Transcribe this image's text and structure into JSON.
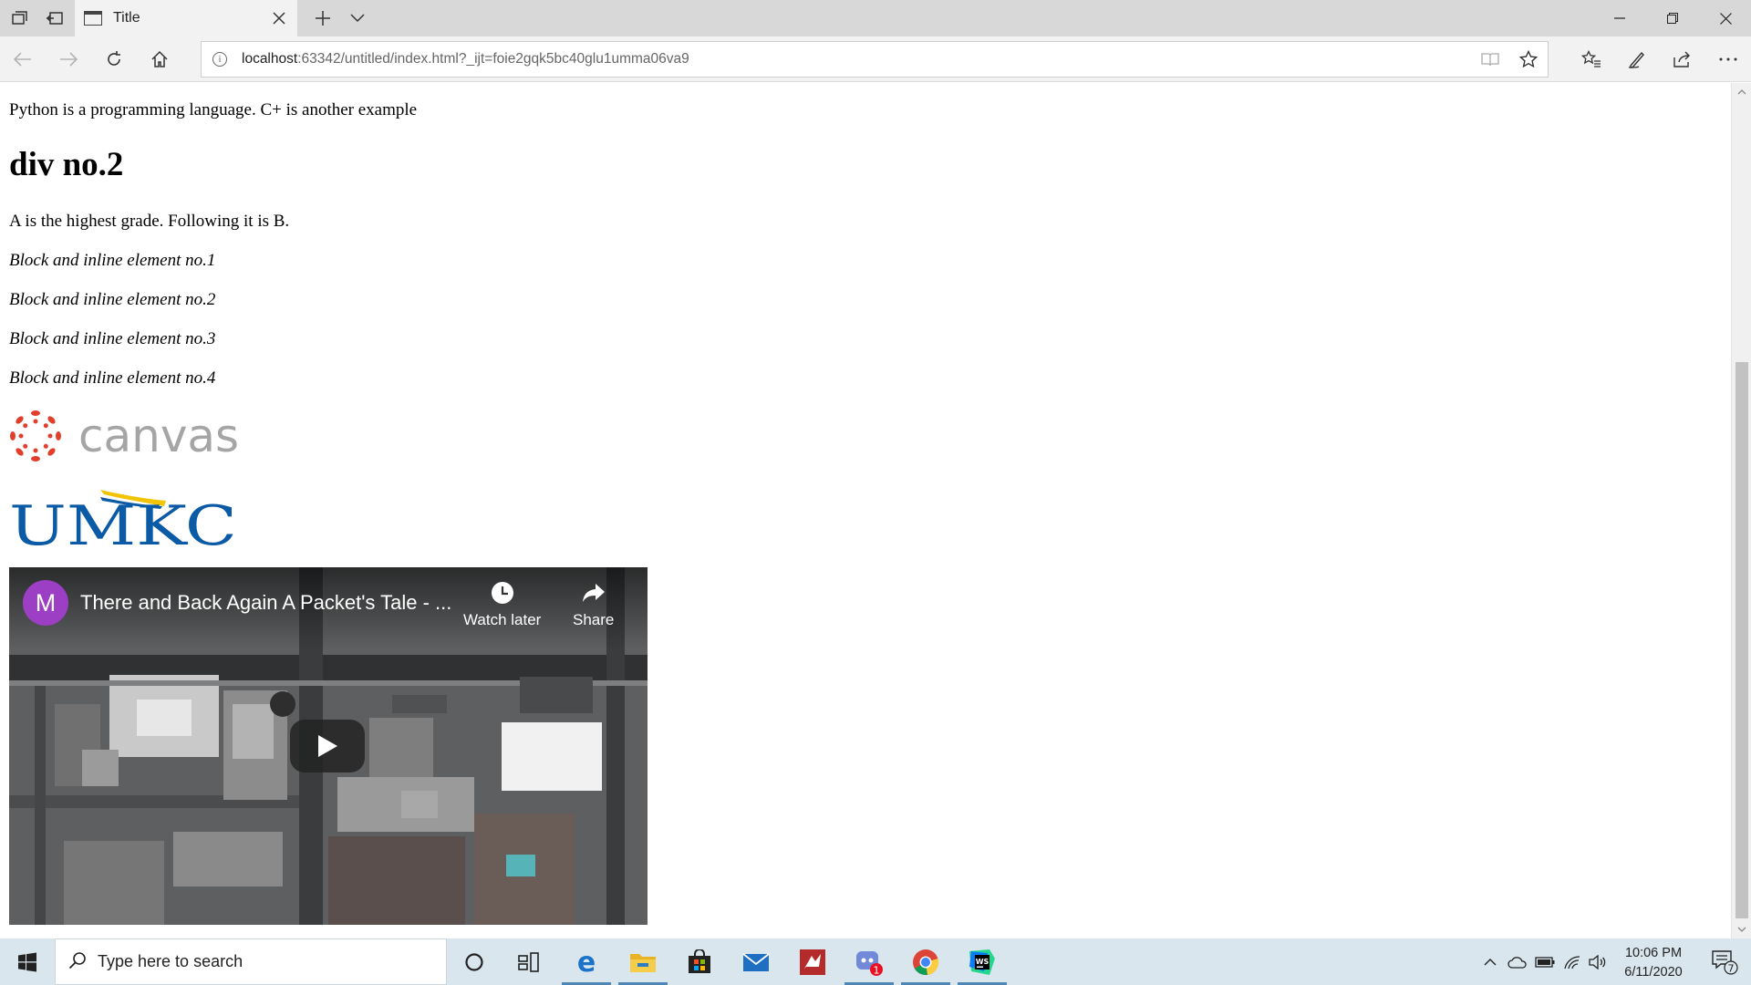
{
  "browser": {
    "tab": {
      "title": "Title"
    },
    "address": {
      "host": "localhost",
      "rest": ":63342/untitled/index.html?_ijt=foie2gqk5bc40glu1umma06va9"
    }
  },
  "page": {
    "para1": "Python is a programming language. C+ is another example",
    "heading2": "div no.2",
    "para2": "A is the highest grade. Following it is B.",
    "items": [
      "Block and inline element no.1",
      "Block and inline element no.2",
      "Block and inline element no.3",
      "Block and inline element no.4"
    ],
    "canvas_logo_text": "canvas",
    "umkc_logo_text": "UMKC",
    "video": {
      "channel_initial": "M",
      "title": "There and Back Again A Packet's Tale - ...",
      "watch_later": "Watch later",
      "share": "Share"
    }
  },
  "taskbar": {
    "search_placeholder": "Type here to search",
    "discord_badge": "1",
    "time": "10:06 PM",
    "date": "6/11/2020",
    "notification_count": "7"
  },
  "colors": {
    "canvas_red": "#e13f2b",
    "canvas_gray": "#a5a5a5",
    "umkc_blue": "#0a5aa5",
    "umkc_gold": "#f2c300",
    "avatar_purple": "#9d3fc4",
    "taskbar": "#d9e6ee"
  },
  "icons": [
    "tab-actions-icon",
    "tab-aside-icon",
    "page-icon",
    "close-icon",
    "new-tab-icon",
    "chevron-down-icon",
    "minimize-icon",
    "restore-icon",
    "back-icon",
    "forward-icon",
    "refresh-icon",
    "home-icon",
    "info-icon",
    "reading-view-icon",
    "star-icon",
    "favorites-icon",
    "pen-icon",
    "share-icon",
    "more-icon",
    "clock-icon",
    "play-icon",
    "windows-icon",
    "search-icon",
    "cortana-icon",
    "task-view-icon",
    "edge-icon",
    "file-explorer-icon",
    "store-icon",
    "mail-icon",
    "chrome-icon",
    "webstorm-icon"
  ]
}
